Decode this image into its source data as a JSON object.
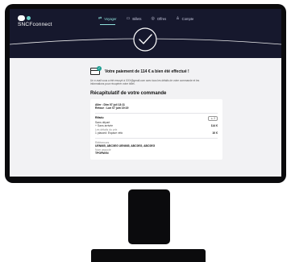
{
  "brand": {
    "name": "SNCFconnect"
  },
  "nav": {
    "items": [
      {
        "label": "Voyager",
        "icon": "⇄",
        "icon_name": "train-swap-icon",
        "active": true
      },
      {
        "label": "Billets",
        "icon": "▭",
        "icon_name": "ticket-icon",
        "active": false
      },
      {
        "label": "Offres",
        "icon": "◎",
        "icon_name": "offers-icon",
        "active": false
      },
      {
        "label": "Compte",
        "icon": "♙",
        "icon_name": "account-icon",
        "active": false
      }
    ]
  },
  "success": {
    "title": "Votre paiement de 114 € a bien été effectué !",
    "check_glyph": "✓"
  },
  "info_text": "Un e-mail vous a été envoyé à XXX@gmail.com avec tous les détails de votre commande et les informations pour récupérer votre billet.",
  "recap": {
    "title": "Récapitulatif de votre commande",
    "outbound": "Aller : Dim 07 juil 13:11",
    "return": "Retour : Lun 07 juin 19:19",
    "route_title": "Rifadu",
    "passengers_badge": "2",
    "passengers_icon": "♙",
    "fare_label": "Sans départ",
    "item_line": "+ Sans arrivée",
    "item_sub": "Les détails du prix",
    "item_price": "114 €",
    "extra_line": "1 placard: Espace vélo",
    "extra_price": "10 €",
    "refs_label": "Références",
    "refs_value": "UEN665, ABC0EG UEN665, ABC0EG, ABC0EG",
    "ref_pass_label": "Nom associé",
    "ref_pass_value": "TPGFMVN"
  },
  "colors": {
    "header_bg": "#16182d",
    "accent": "#8fe2dc",
    "success": "#1f9e92"
  }
}
